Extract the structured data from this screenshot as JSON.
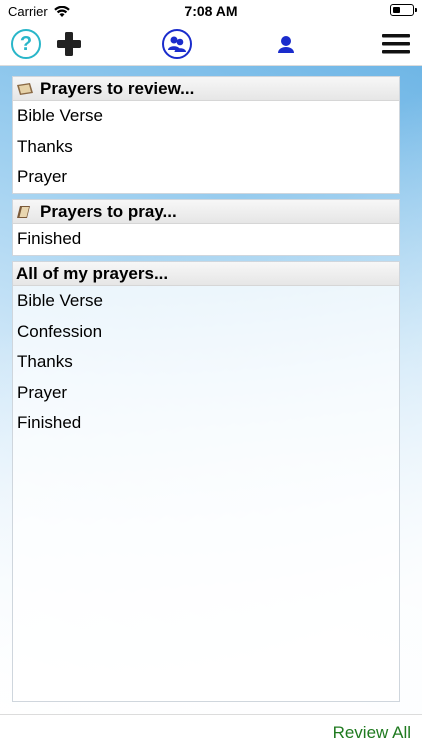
{
  "status_bar": {
    "carrier": "Carrier",
    "time": "7:08 AM"
  },
  "colors": {
    "help_accent": "#29b6c9",
    "group_accent": "#1a2ccc",
    "review_all": "#1f7a1f"
  },
  "toolbar": {
    "help_symbol": "?"
  },
  "sections": {
    "review": {
      "title": "Prayers to review...",
      "items": [
        "Bible Verse",
        "Thanks",
        "Prayer"
      ]
    },
    "pray": {
      "title": "Prayers to pray...",
      "items": [
        "Finished"
      ]
    },
    "all": {
      "title": "All of my prayers...",
      "items": [
        "Bible Verse",
        "Confession",
        "Thanks",
        "Prayer",
        "Finished"
      ]
    }
  },
  "bottom_bar": {
    "review_all_label": "Review All"
  }
}
